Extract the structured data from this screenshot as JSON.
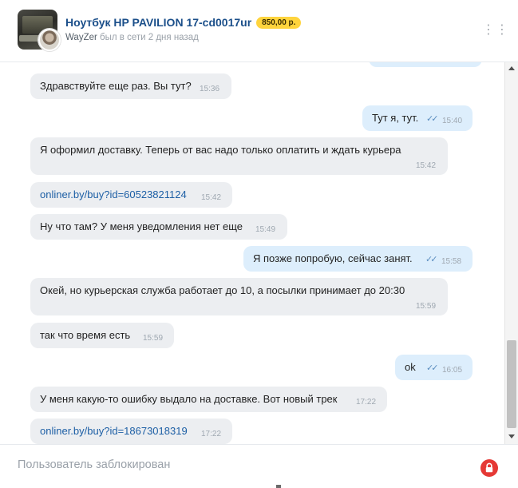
{
  "header": {
    "title": "Ноутбук HP PAVILION 17-cd0017ur",
    "price": "850,00 р.",
    "user": "WayZer",
    "status": "был в сети 2 дня назад",
    "more_icon": "⋮⋮"
  },
  "messages": [
    {
      "dir": "in",
      "text": "Здравствуйте еще раз. Вы тут?",
      "time": "15:36"
    },
    {
      "dir": "out",
      "text": "Тут я, тут.",
      "time": "15:40",
      "read": true
    },
    {
      "dir": "in",
      "text": "Я оформил доставку. Теперь от вас надо только оплатить и ждать курьера",
      "time": "15:42"
    },
    {
      "dir": "in",
      "text": "onliner.by/buy?id=60523821124",
      "time": "15:42",
      "link": true
    },
    {
      "dir": "in",
      "text": "Ну что там? У меня уведомления нет еще",
      "time": "15:49"
    },
    {
      "dir": "out",
      "text": "Я позже попробую, сейчас занят.",
      "time": "15:58",
      "read": true
    },
    {
      "dir": "in",
      "text": "Окей, но курьерская служба работает до 10, а посылки принимает до 20:30",
      "time": "15:59"
    },
    {
      "dir": "in",
      "text": "так что время есть",
      "time": "15:59"
    },
    {
      "dir": "out",
      "text": "ok",
      "time": "16:05",
      "read": true
    },
    {
      "dir": "in",
      "text": "У меня какую-то ошибку выдало на доставке. Вот новый трек",
      "time": "17:22"
    },
    {
      "dir": "in",
      "text": "onliner.by/buy?id=18673018319",
      "time": "17:22",
      "link": true
    }
  ],
  "footer": {
    "blocked_text": "Пользователь заблокирован",
    "lock_icon": "lock-icon"
  },
  "colors": {
    "accent": "#1b4f8a",
    "price_badge": "#ffd43d",
    "incoming_bubble": "#eceef1",
    "outgoing_bubble": "#ddeefc",
    "lock": "#e53935"
  }
}
